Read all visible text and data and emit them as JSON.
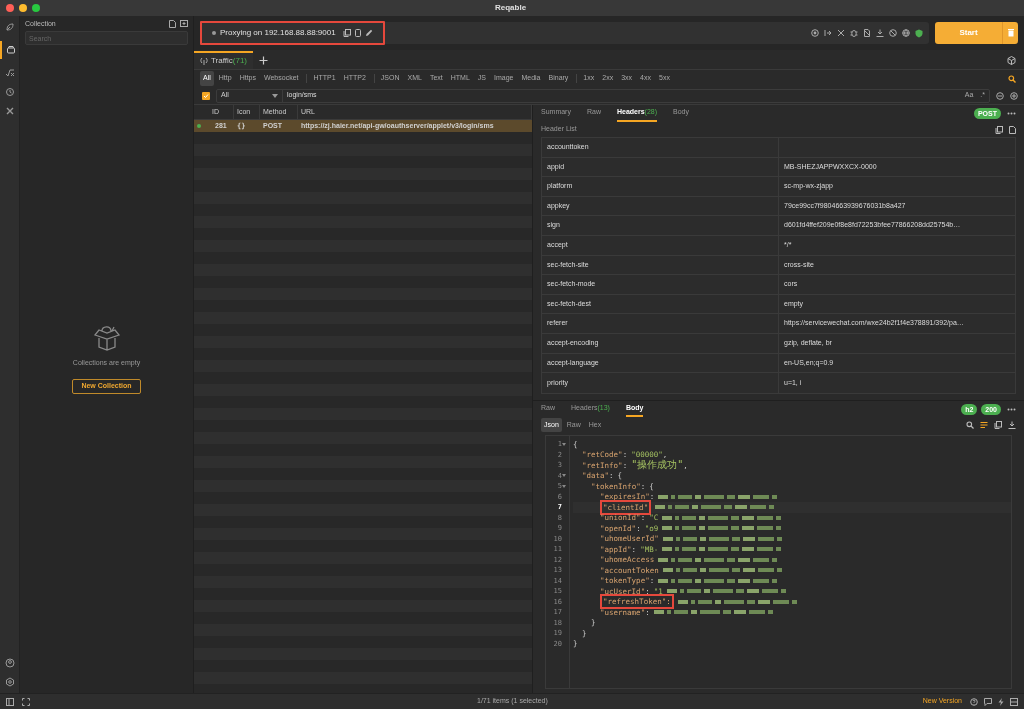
{
  "window": {
    "title": "Reqable"
  },
  "collection": {
    "title": "Collection",
    "search_placeholder": "Search",
    "empty_text": "Collections are empty",
    "button": "New Collection"
  },
  "proxy": {
    "label": "Proxying on 192.168.88.88:9001",
    "annotated": true
  },
  "start_button": "Start",
  "traffic_tab": {
    "label": "Traffic",
    "count": "(71)",
    "selected": true
  },
  "filters": [
    {
      "label": "All",
      "selected": true,
      "group_end": false
    },
    {
      "label": "Http",
      "selected": false,
      "group_end": false
    },
    {
      "label": "Https",
      "selected": false,
      "group_end": false
    },
    {
      "label": "Websocket",
      "selected": false,
      "group_end": true
    },
    {
      "label": "HTTP1",
      "selected": false,
      "group_end": false
    },
    {
      "label": "HTTP2",
      "selected": false,
      "group_end": true
    },
    {
      "label": "JSON",
      "selected": false,
      "group_end": false
    },
    {
      "label": "XML",
      "selected": false,
      "group_end": false
    },
    {
      "label": "Text",
      "selected": false,
      "group_end": false
    },
    {
      "label": "HTML",
      "selected": false,
      "group_end": false
    },
    {
      "label": "JS",
      "selected": false,
      "group_end": false
    },
    {
      "label": "Image",
      "selected": false,
      "group_end": false
    },
    {
      "label": "Media",
      "selected": false,
      "group_end": false
    },
    {
      "label": "Binary",
      "selected": false,
      "group_end": true
    },
    {
      "label": "1xx",
      "selected": false,
      "group_end": false
    },
    {
      "label": "2xx",
      "selected": false,
      "group_end": false
    },
    {
      "label": "3xx",
      "selected": false,
      "group_end": false
    },
    {
      "label": "4xx",
      "selected": false,
      "group_end": false
    },
    {
      "label": "5xx",
      "selected": false,
      "group_end": false
    }
  ],
  "search": {
    "checked": true,
    "scope": "All",
    "value": "login/sms",
    "case_option": "Aa",
    "regex_option": ".*"
  },
  "table": {
    "columns": [
      "ID",
      "Icon",
      "Method",
      "URL"
    ],
    "rows": [
      {
        "id": "281",
        "icon": "{}",
        "method": "POST",
        "url": "https://zj.haier.net/api-gw/oauthserver/applet/v3/login/sms",
        "selected": true,
        "color": "#4caf50"
      }
    ]
  },
  "request": {
    "tabs": [
      {
        "label": "Summary",
        "selected": false
      },
      {
        "label": "Raw",
        "selected": false
      },
      {
        "label": "Headers",
        "count": "(28)",
        "selected": true
      },
      {
        "label": "Body",
        "selected": false
      }
    ],
    "method_badge": "POST",
    "list_title": "Header List",
    "headers": [
      {
        "name": "accounttoken"
      },
      {
        "name": "appid",
        "value": "MB-SHEZJAPPWXXCX-0000"
      },
      {
        "name": "platform",
        "value": "sc-mp-wx-zjapp"
      },
      {
        "name": "appkey",
        "value": "79ce99cc7f9804663939676031b8a427"
      },
      {
        "name": "sign",
        "value": "d601fd4ffef209e0f8e8fd72253bfee77866208dd25754b…"
      },
      {
        "name": "accept",
        "value": "*/*"
      },
      {
        "name": "sec-fetch-site",
        "value": "cross-site"
      },
      {
        "name": "sec-fetch-mode",
        "value": "cors"
      },
      {
        "name": "sec-fetch-dest",
        "value": "empty"
      },
      {
        "name": "referer",
        "value": "https://servicewechat.com/wxe24b2f1f4e378891/392/pa…"
      },
      {
        "name": "accept-encoding",
        "value": "gzip, deflate, br"
      },
      {
        "name": "accept-language",
        "value": "en-US,en;q=0.9"
      },
      {
        "name": "priority",
        "value": "u=1, i"
      }
    ]
  },
  "response": {
    "tabs": [
      {
        "label": "Raw",
        "selected": false
      },
      {
        "label": "Headers",
        "count": "(13)",
        "selected": false
      },
      {
        "label": "Body",
        "selected": true
      }
    ],
    "badges": [
      "h2",
      "200"
    ],
    "formats": [
      {
        "label": "Json",
        "selected": true
      },
      {
        "label": "Raw",
        "selected": false
      },
      {
        "label": "Hex",
        "selected": false
      }
    ],
    "lines": [
      {
        "number": "1",
        "foldable": true,
        "current": false,
        "segments": [
          {
            "kind": "punct",
            "text": "{"
          }
        ]
      },
      {
        "number": "2",
        "foldable": false,
        "current": false,
        "segments": [
          {
            "kind": "key",
            "text": "\"retCode\""
          },
          {
            "kind": "punct",
            "text": ":"
          },
          {
            "kind": "string",
            "text": "\"00000\""
          },
          {
            "kind": "punct",
            "text": ","
          }
        ]
      },
      {
        "number": "3",
        "foldable": false,
        "current": false,
        "segments": [
          {
            "kind": "key",
            "text": "\"retInfo\""
          },
          {
            "kind": "punct",
            "text": ":"
          },
          {
            "kind": "string",
            "text": "\"操作成功\""
          },
          {
            "kind": "punct",
            "text": ","
          }
        ]
      },
      {
        "number": "4",
        "foldable": true,
        "current": false,
        "segments": [
          {
            "kind": "key",
            "text": "\"data\""
          },
          {
            "kind": "punct",
            "text": ":"
          },
          {
            "kind": "punct",
            "text": "{"
          }
        ]
      },
      {
        "number": "5",
        "foldable": true,
        "current": false,
        "segments": [
          {
            "kind": "key",
            "text": "\"tokenInfo\""
          },
          {
            "kind": "punct",
            "text": ":"
          },
          {
            "kind": "punct",
            "text": "{"
          }
        ]
      },
      {
        "number": "6",
        "foldable": false,
        "current": false,
        "segments": [
          {
            "kind": "key",
            "text": "\"expiresIn\""
          },
          {
            "kind": "punct",
            "text": ":"
          },
          {
            "kind": "redacted"
          }
        ]
      },
      {
        "number": "7",
        "foldable": false,
        "current": true,
        "segments": [
          {
            "kind": "annotated",
            "text": "\"clientId\""
          },
          {
            "kind": "redacted"
          }
        ]
      },
      {
        "number": "8",
        "foldable": false,
        "current": false,
        "segments": [
          {
            "kind": "key",
            "text": "\"unionId\""
          },
          {
            "kind": "punct",
            "text": ":"
          },
          {
            "kind": "string",
            "text": "\"C"
          },
          {
            "kind": "redacted"
          }
        ]
      },
      {
        "number": "9",
        "foldable": false,
        "current": false,
        "segments": [
          {
            "kind": "key",
            "text": "\"openId\""
          },
          {
            "kind": "punct",
            "text": ":"
          },
          {
            "kind": "string",
            "text": "\"o9"
          },
          {
            "kind": "redacted"
          }
        ]
      },
      {
        "number": "10",
        "foldable": false,
        "current": false,
        "segments": [
          {
            "kind": "key",
            "text": "\"uhomeUserId\""
          },
          {
            "kind": "redacted"
          }
        ]
      },
      {
        "number": "11",
        "foldable": false,
        "current": false,
        "segments": [
          {
            "kind": "key",
            "text": "\"appId\""
          },
          {
            "kind": "punct",
            "text": ":"
          },
          {
            "kind": "string",
            "text": "\"MB-"
          },
          {
            "kind": "redacted"
          }
        ]
      },
      {
        "number": "12",
        "foldable": false,
        "current": false,
        "segments": [
          {
            "kind": "key",
            "text": "\"uhomeAccess"
          },
          {
            "kind": "redacted"
          }
        ]
      },
      {
        "number": "13",
        "foldable": false,
        "current": false,
        "segments": [
          {
            "kind": "key",
            "text": "\"accountToken"
          },
          {
            "kind": "redacted"
          }
        ]
      },
      {
        "number": "14",
        "foldable": false,
        "current": false,
        "segments": [
          {
            "kind": "key",
            "text": "\"tokenType\""
          },
          {
            "kind": "punct",
            "text": ":"
          },
          {
            "kind": "redacted"
          }
        ]
      },
      {
        "number": "15",
        "foldable": false,
        "current": false,
        "segments": [
          {
            "kind": "key",
            "text": "\"ucUserId\""
          },
          {
            "kind": "punct",
            "text": ":"
          },
          {
            "kind": "string",
            "text": "\"1"
          },
          {
            "kind": "redacted"
          }
        ]
      },
      {
        "number": "16",
        "foldable": false,
        "current": false,
        "segments": [
          {
            "kind": "annotated",
            "text": "\"refreshToken\":"
          },
          {
            "kind": "redacted"
          }
        ]
      },
      {
        "number": "17",
        "foldable": false,
        "current": false,
        "segments": [
          {
            "kind": "key",
            "text": "\"username\""
          },
          {
            "kind": "punct",
            "text": ":"
          },
          {
            "kind": "redacted"
          }
        ]
      },
      {
        "number": "18",
        "foldable": false,
        "current": false,
        "segments": [
          {
            "kind": "punct",
            "text": "}"
          }
        ]
      },
      {
        "number": "19",
        "foldable": false,
        "current": false,
        "segments": [
          {
            "kind": "punct",
            "text": "}"
          }
        ]
      },
      {
        "number": "20",
        "foldable": false,
        "current": false,
        "segments": [
          {
            "kind": "punct",
            "text": "}"
          }
        ]
      }
    ]
  },
  "status_bar": {
    "summary": "1/71 items (1 selected)",
    "new_version": "New Version"
  }
}
